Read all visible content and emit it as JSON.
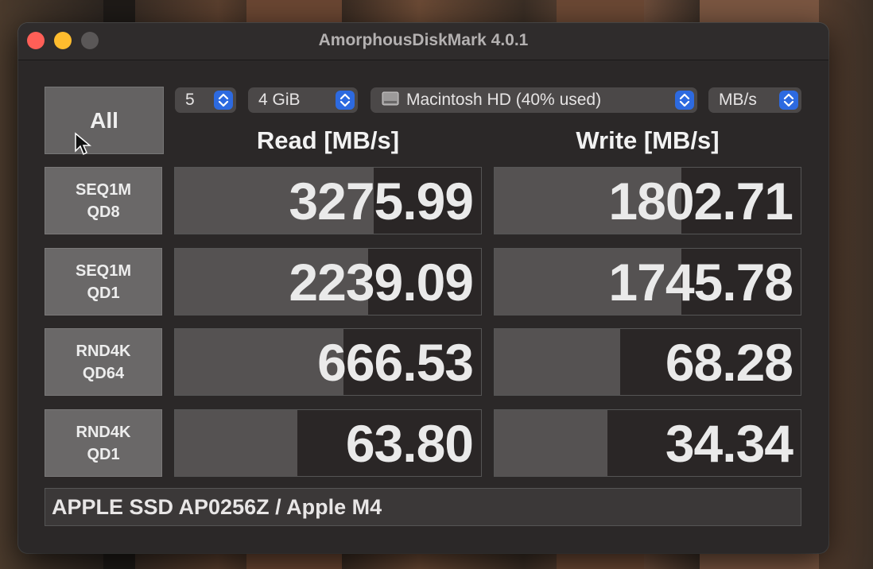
{
  "window": {
    "title": "AmorphousDiskMark 4.0.1"
  },
  "controls": {
    "all_label": "All",
    "count": {
      "value": "5"
    },
    "size": {
      "value": "4 GiB"
    },
    "drive": {
      "value": "Macintosh HD (40% used)",
      "icon": "drive-icon"
    },
    "unit": {
      "value": "MB/s"
    }
  },
  "headers": {
    "read": "Read [MB/s]",
    "write": "Write [MB/s]"
  },
  "rows": [
    {
      "label1": "SEQ1M",
      "label2": "QD8",
      "read": "3275.99",
      "read_fill": 0.65,
      "write": "1802.71",
      "write_fill": 0.61
    },
    {
      "label1": "SEQ1M",
      "label2": "QD1",
      "read": "2239.09",
      "read_fill": 0.63,
      "write": "1745.78",
      "write_fill": 0.61
    },
    {
      "label1": "RND4K",
      "label2": "QD64",
      "read": "666.53",
      "read_fill": 0.55,
      "write": "68.28",
      "write_fill": 0.41
    },
    {
      "label1": "RND4K",
      "label2": "QD1",
      "read": "63.80",
      "read_fill": 0.4,
      "write": "34.34",
      "write_fill": 0.37
    }
  ],
  "footer": {
    "text": "APPLE SSD AP0256Z / Apple M4"
  },
  "colors": {
    "close": "#ff5f57",
    "minimize": "#febc2e",
    "accent": "#2d6ae0"
  }
}
